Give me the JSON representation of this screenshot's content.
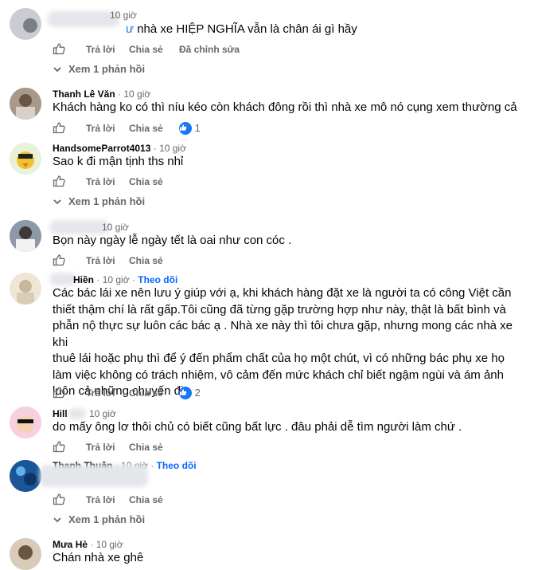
{
  "ui": {
    "reply_label": "Trả lời",
    "share_label": "Chia sẻ",
    "edited_label": "Đã chỉnh sửa",
    "follow_label": "Theo dõi",
    "colors": {
      "link": "#0866ff",
      "muted": "#65676b",
      "like": "#1877f2",
      "text": "#050505"
    }
  },
  "comments": [
    {
      "author": "",
      "time": "10 giờ",
      "text": "nhà xe HIỆP NGHĨA vẫn là chân ái gì hầy",
      "text_prefix_partial": "ư",
      "edited": "Đã chỉnh sửa",
      "view_replies": "Xem 1 phản hồi"
    },
    {
      "author": "Thanh Lê Văn",
      "time": "10 giờ",
      "text": "Khách hàng ko có thì níu kéo còn khách đông rồi thì nhà xe mô nó cụng xem thường cả",
      "reaction_count": "1"
    },
    {
      "author": "HandsomeParrot4013",
      "time": "10 giờ",
      "text": "Sao k đi mận tịnh ths nhỉ",
      "view_replies": "Xem 1 phản hồi"
    },
    {
      "author": "",
      "time": "10 giờ",
      "text": "Bọn này ngày lễ ngày tết là oai như con cóc ."
    },
    {
      "author": "Hiền",
      "time": "10 giờ",
      "follow": "Theo dõi",
      "text_lines": [
        "Các bác lái xe nên lưu ý giúp với ạ, khi khách hàng đặt xe là người ta có công Việt cần",
        "thiết thậm chí là rất gấp.Tôi cũng đã từng gặp trường hợp như này, thật là bất bình và",
        "phẫn nộ thực sự luôn các bác ạ . Nhà xe này thì tôi chưa gặp, nhưng mong các nhà xe khi",
        "thuê lái hoặc phụ thì để ý đến phẩm chất của họ một chút, vì có những bác phụ xe họ",
        "làm việc không có trách nhiệm, vô cảm đến mức khách chỉ biết ngậm ngùi và ám ảnh",
        "luôn cả những chuyến đi."
      ],
      "reaction_count": "2"
    },
    {
      "author": "Hill",
      "time": "10 giờ",
      "text": "do mấy ông lơ thôi chủ có biết cũng bất lực . đâu phải dễ tìm người làm chứ ."
    },
    {
      "author": "Thanh Thuận",
      "time": "10 giờ",
      "follow": "Theo dõi",
      "text": "",
      "view_replies": "Xem 1 phản hồi"
    },
    {
      "author": "Mưa Hè",
      "time": "10 giờ",
      "text": "Chán nhà xe ghê"
    }
  ]
}
